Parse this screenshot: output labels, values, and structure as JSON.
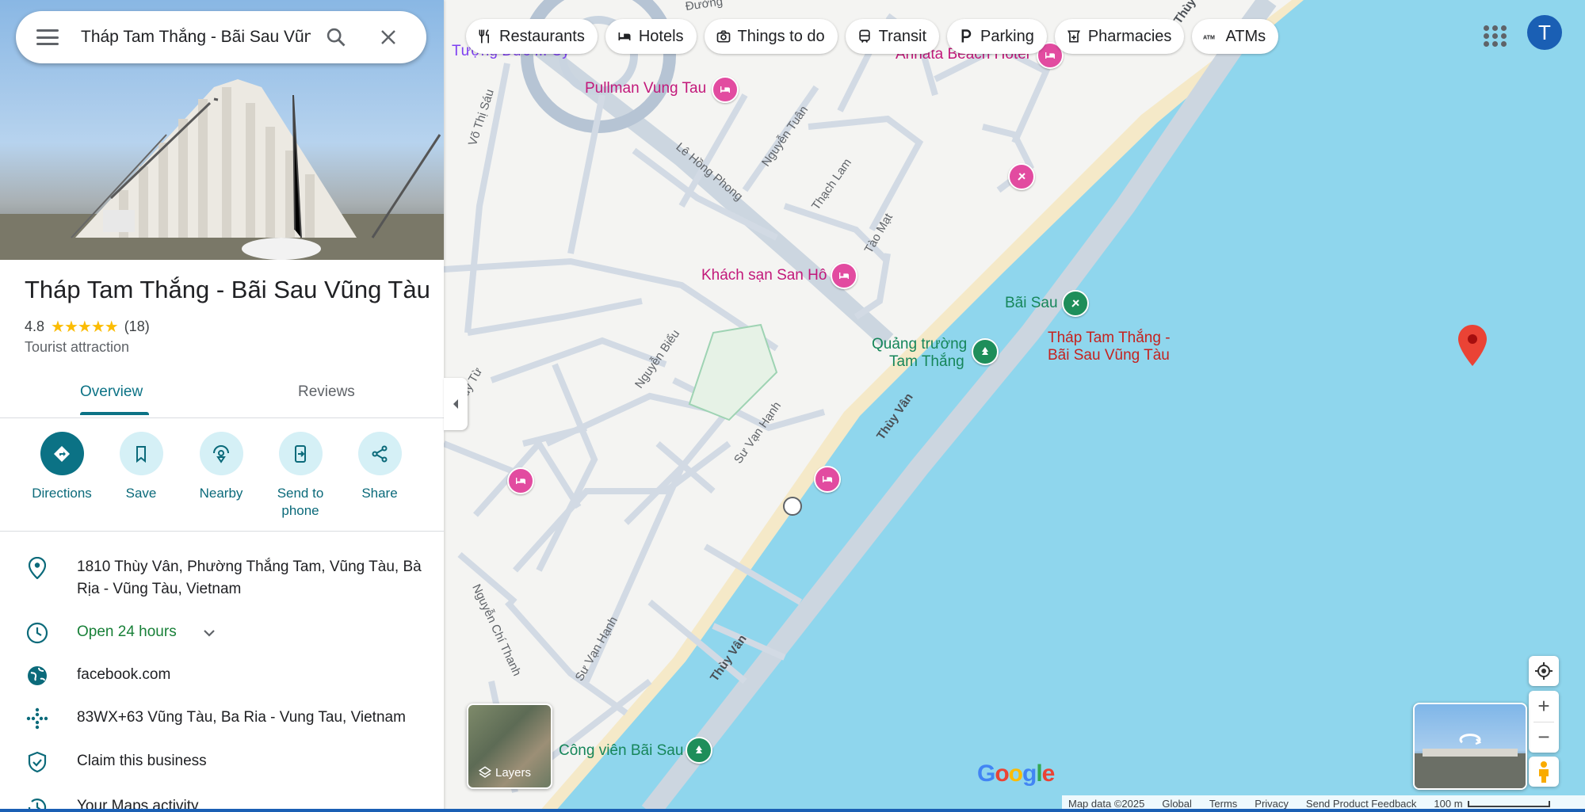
{
  "search": {
    "query": "Tháp Tam Thắng - Bãi Sau Vũng Tàu"
  },
  "chips": [
    {
      "label": "Restaurants",
      "icon": "fork-knife-icon"
    },
    {
      "label": "Hotels",
      "icon": "bed-icon"
    },
    {
      "label": "Things to do",
      "icon": "camera-icon"
    },
    {
      "label": "Transit",
      "icon": "train-icon"
    },
    {
      "label": "Parking",
      "icon": "parking-icon"
    },
    {
      "label": "Pharmacies",
      "icon": "pharmacy-icon"
    },
    {
      "label": "ATMs",
      "icon": "atm-icon"
    }
  ],
  "account": {
    "initial": "T",
    "color": "#1a5fb4"
  },
  "place": {
    "name": "Tháp Tam Thắng - Bãi Sau Vũng Tàu",
    "rating": "4.8",
    "stars": "★★★★★",
    "reviews_count": "(18)",
    "category": "Tourist attraction"
  },
  "tabs": {
    "overview": "Overview",
    "reviews": "Reviews"
  },
  "actions": {
    "directions": "Directions",
    "save": "Save",
    "nearby": "Nearby",
    "send_to_phone": "Send to phone",
    "share": "Share"
  },
  "info": {
    "address": "1810 Thùy Vân, Phường Thắng Tam, Vũng Tàu, Bà Rịa - Vũng Tàu, Vietnam",
    "hours": "Open 24 hours",
    "website": "facebook.com",
    "plus_code": "83WX+63 Vũng Tàu, Ba Ria - Vung Tau, Vietnam",
    "claim": "Claim this business",
    "maps_activity": "Your Maps activity"
  },
  "map": {
    "pois": {
      "tuong": "Tượng Đức ... Cy",
      "pullman": "Pullman Vung Tau",
      "annata": "Annata Beach Hotel",
      "san_ho": "Khách sạn San Hô",
      "bai_sau": "Bãi Sau",
      "quang_truong_1": "Quảng trường",
      "quang_truong_2": "Tam Thắng",
      "selected_1": "Tháp Tam Thắng -",
      "selected_2": "Bãi Sau Vũng Tàu",
      "cong_vien": "Công viên Bãi Sau"
    },
    "streets": {
      "vo_thi_sau": "Võ Thị Sáu",
      "le_hong_phong": "Lê Hồng Phong",
      "nguyen_tuan": "Nguyễn Tuân",
      "thach_lam": "Thạch Lam",
      "tao_mat": "Tào Mạt",
      "nguyen_bieu": "Nguyễn Biểu",
      "duy_tu": "Duy Từ",
      "su_van_hanh": "Sư Vạn Hạnh",
      "thuy_van": "Thùy Vân",
      "nguyen_chi_thanh": "Nguyễn Chí Thanh",
      "duong": "Đường",
      "thuy": "Thùy"
    },
    "layers_label": "Layers",
    "logo": "Google",
    "footer": {
      "map_data": "Map data ©2025",
      "global": "Global",
      "terms": "Terms",
      "privacy": "Privacy",
      "feedback": "Send Product Feedback",
      "scale": "100 m"
    }
  }
}
